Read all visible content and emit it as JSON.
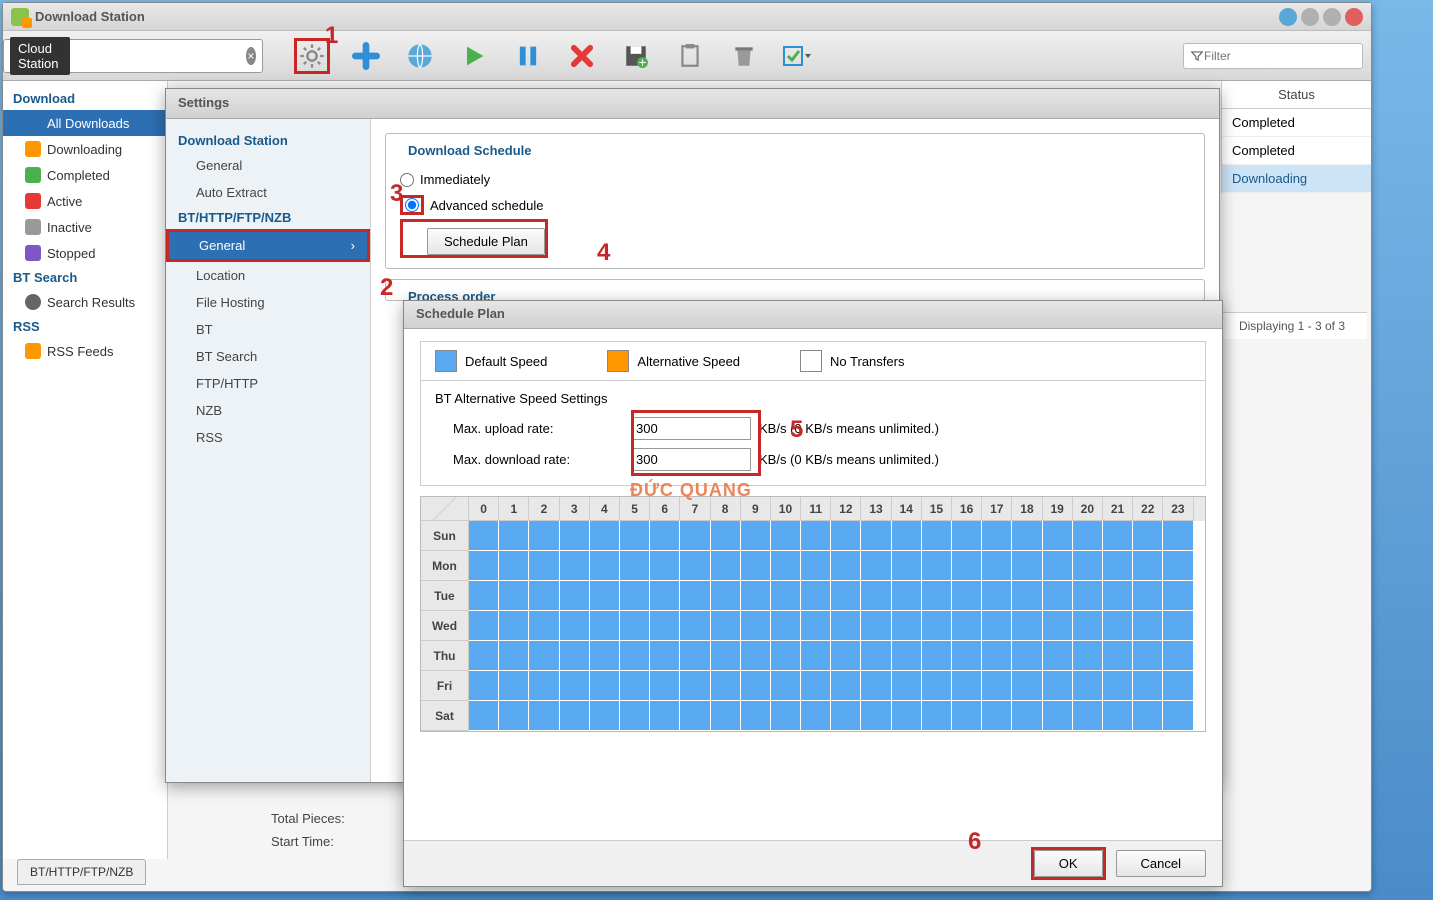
{
  "app": {
    "title": "Download Station"
  },
  "search": {
    "tag": "Cloud Station"
  },
  "filter": {
    "placeholder": "Filter"
  },
  "leftnav": {
    "download": "Download",
    "items": [
      "All Downloads",
      "Downloading",
      "Completed",
      "Active",
      "Inactive",
      "Stopped"
    ],
    "btsearch": "BT Search",
    "search_results": "Search Results",
    "rss": "RSS",
    "rss_feeds": "RSS Feeds"
  },
  "rightpanel": {
    "header": "Status",
    "rows": [
      "Completed",
      "Completed",
      "Downloading"
    ]
  },
  "pagination": "Displaying 1 - 3 of 3",
  "settings": {
    "title": "Settings",
    "groups": [
      {
        "name": "Download Station",
        "items": [
          "General",
          "Auto Extract"
        ]
      },
      {
        "name": "BT/HTTP/FTP/NZB",
        "items": [
          "General",
          "Location",
          "File Hosting",
          "BT",
          "BT Search",
          "FTP/HTTP",
          "NZB",
          "RSS"
        ]
      }
    ],
    "panel": {
      "dl_sched_title": "Download Schedule",
      "immediately": "Immediately",
      "advanced": "Advanced schedule",
      "sched_plan_btn": "Schedule Plan",
      "process_order": "Process order"
    }
  },
  "schedPlan": {
    "title": "Schedule Plan",
    "legend": {
      "def": "Default Speed",
      "alt": "Alternative Speed",
      "none": "No Transfers"
    },
    "bt_title": "BT Alternative Speed Settings",
    "upload_label": "Max. upload rate:",
    "download_label": "Max. download rate:",
    "upload_val": "300",
    "download_val": "300",
    "unit_hint": "KB/s (0 KB/s means unlimited.)",
    "hours": [
      "0",
      "1",
      "2",
      "3",
      "4",
      "5",
      "6",
      "7",
      "8",
      "9",
      "10",
      "11",
      "12",
      "13",
      "14",
      "15",
      "16",
      "17",
      "18",
      "19",
      "20",
      "21",
      "22",
      "23"
    ],
    "days": [
      "Sun",
      "Mon",
      "Tue",
      "Wed",
      "Thu",
      "Fri",
      "Sat"
    ],
    "ok": "OK",
    "cancel": "Cancel"
  },
  "info": {
    "pieces": "Total Pieces:",
    "start": "Start Time:"
  },
  "bottomTab": "BT/HTTP/FTP/NZB",
  "annotations": {
    "a1": "1",
    "a2": "2",
    "a3": "3",
    "a4": "4",
    "a5": "5",
    "a6": "6"
  },
  "watermark": "ĐỨC QUANG"
}
